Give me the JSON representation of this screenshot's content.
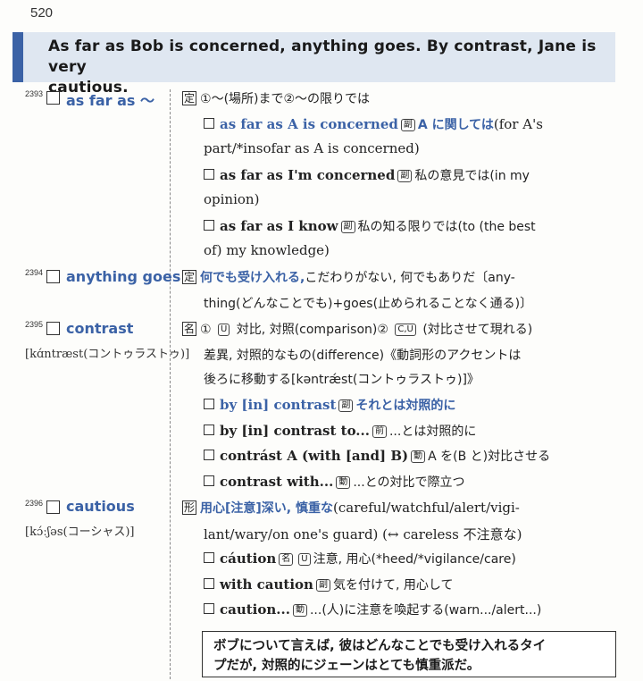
{
  "page": {
    "number": "520"
  },
  "banner": {
    "line1": "As far as Bob is concerned, anything goes. By contrast, Jane is very",
    "line2": "cautious."
  },
  "entries": [
    {
      "num": "2393",
      "headword": "as far as 〜",
      "lines": [
        {
          "pos": "定",
          "text": "①〜(場所)まで②〜の限りでは"
        },
        {
          "phrase": "as far as A is concerned",
          "tag": "副",
          "meaning": "A に関しては",
          "rest": "(for A's"
        },
        {
          "text": "part/*insofar as A is concerned)"
        },
        {
          "phrase": "as far as I'm concerned",
          "tag": "副",
          "meaning": "私の意見では(in my"
        },
        {
          "text": "opinion)"
        },
        {
          "phrase": "as far as I know",
          "tag": "副",
          "meaning": "私の知る限りでは(to (the best"
        },
        {
          "text": "of) my knowledge)"
        }
      ]
    },
    {
      "num": "2394",
      "headword": "anything goes",
      "lines": [
        {
          "pos": "定",
          "blue": "何でも受け入れる,",
          "text": "こだわりがない, 何でもありだ〔any-"
        },
        {
          "text": "thing(どんなことでも)+goes(止められることなく通る)〕"
        }
      ]
    },
    {
      "num": "2395",
      "headword": "contrast",
      "pron": "[kɑ́ntræst(コントゥラストゥ)]",
      "lines": [
        {
          "pos": "名",
          "text1": "① ",
          "u": "U",
          "text2": " 対比, 対照(comparison)② ",
          "cu": "C,U",
          "text3": " (対比させて現れる)"
        },
        {
          "text": "差異, 対照的なもの(difference)《動詞形のアクセントは"
        },
        {
          "text": "後ろに移動する[kəntrǽst(コントゥラストゥ)]》"
        },
        {
          "phrase": "by [in] contrast",
          "tag": "副",
          "meaning_blue": "それとは対照的に"
        },
        {
          "phrase": "by [in] contrast to...",
          "tag": "前",
          "meaning": "...とは対照的に"
        },
        {
          "phrase": "contrást A (with [and] B)",
          "tag": "動",
          "meaning": "A を(B と)対比させる"
        },
        {
          "phrase": "contrast with...",
          "tag": "動",
          "meaning": "...との対比で際立つ"
        }
      ]
    },
    {
      "num": "2396",
      "headword": "cautious",
      "pron": "[kɔ́ːʃəs(コーシャス)]",
      "lines": [
        {
          "pos": "形",
          "blue": "用心[注意]深い, 慎重な",
          "text": "(careful/watchful/alert/vigi-"
        },
        {
          "text": "lant/wary/on one's guard) (↔ careless 不注意な)"
        },
        {
          "phrase": "cáution",
          "tag": "名",
          "u": "U",
          "meaning": "注意, 用心(*heed/*vigilance/care)"
        },
        {
          "phrase": "with caution",
          "tag": "副",
          "meaning": "気を付けて, 用心して"
        },
        {
          "phrase": "caution...",
          "tag": "動",
          "meaning": "...(人)に注意を喚起する(warn.../alert...)"
        }
      ]
    }
  ],
  "translation": {
    "line1": "ボブについて言えば, 彼はどんなことでも受け入れるタイ",
    "line2": "プだが, 対照的にジェーンはとても慎重派だ。"
  }
}
